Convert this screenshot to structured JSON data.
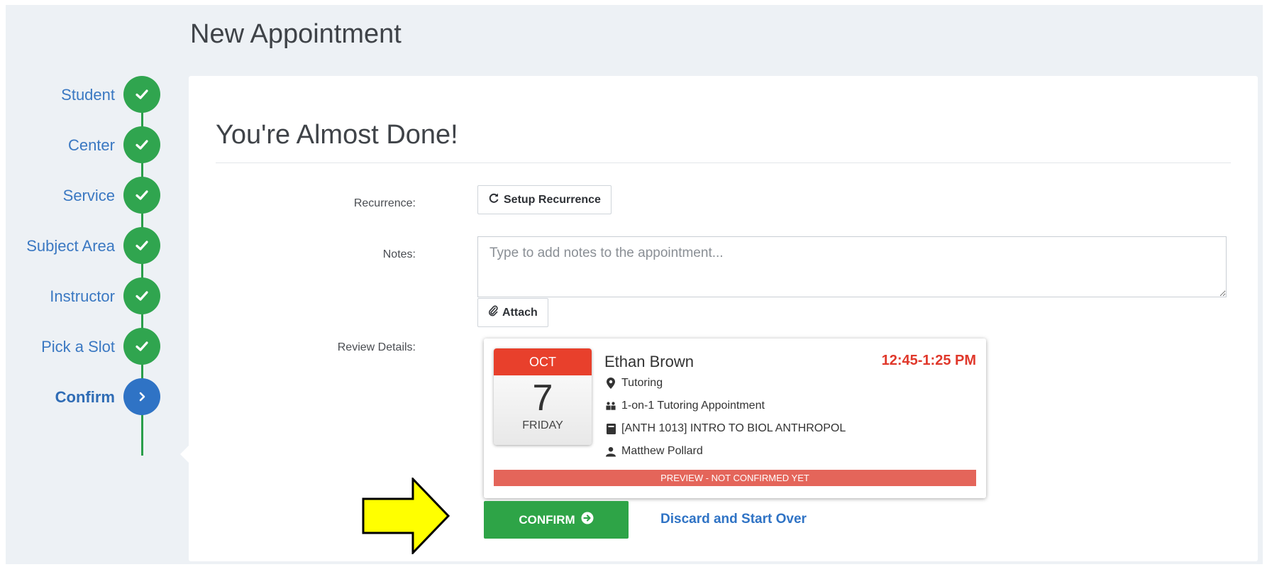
{
  "header": {
    "title": "New Appointment"
  },
  "steps": [
    {
      "label": "Student",
      "state": "done"
    },
    {
      "label": "Center",
      "state": "done"
    },
    {
      "label": "Service",
      "state": "done"
    },
    {
      "label": "Subject Area",
      "state": "done"
    },
    {
      "label": "Instructor",
      "state": "done"
    },
    {
      "label": "Pick a Slot",
      "state": "done"
    },
    {
      "label": "Confirm",
      "state": "active"
    }
  ],
  "card": {
    "title": "You're Almost Done!",
    "recurrence_label": "Recurrence:",
    "recurrence_button": "Setup Recurrence",
    "notes_label": "Notes:",
    "notes_placeholder": "Type to add notes to the appointment...",
    "notes_value": "",
    "attach_button": "Attach",
    "review_label": "Review Details:"
  },
  "review": {
    "month": "OCT",
    "day": "7",
    "weekday": "FRIDAY",
    "name": "Ethan Brown",
    "time": "12:45-1:25 PM",
    "location": "Tutoring",
    "service": "1-on-1 Tutoring Appointment",
    "course": "[ANTH 1013] INTRO TO BIOL ANTHROPOL",
    "instructor": "Matthew Pollard",
    "status": "PREVIEW - NOT CONFIRMED YET"
  },
  "actions": {
    "confirm": "CONFIRM",
    "discard": "Discard and Start Over"
  },
  "colors": {
    "done": "#30a54f",
    "active": "#2f73c5",
    "accent_red": "#e8402c",
    "confirm_green": "#2ea447",
    "annotation_arrow": "#ffff00"
  }
}
